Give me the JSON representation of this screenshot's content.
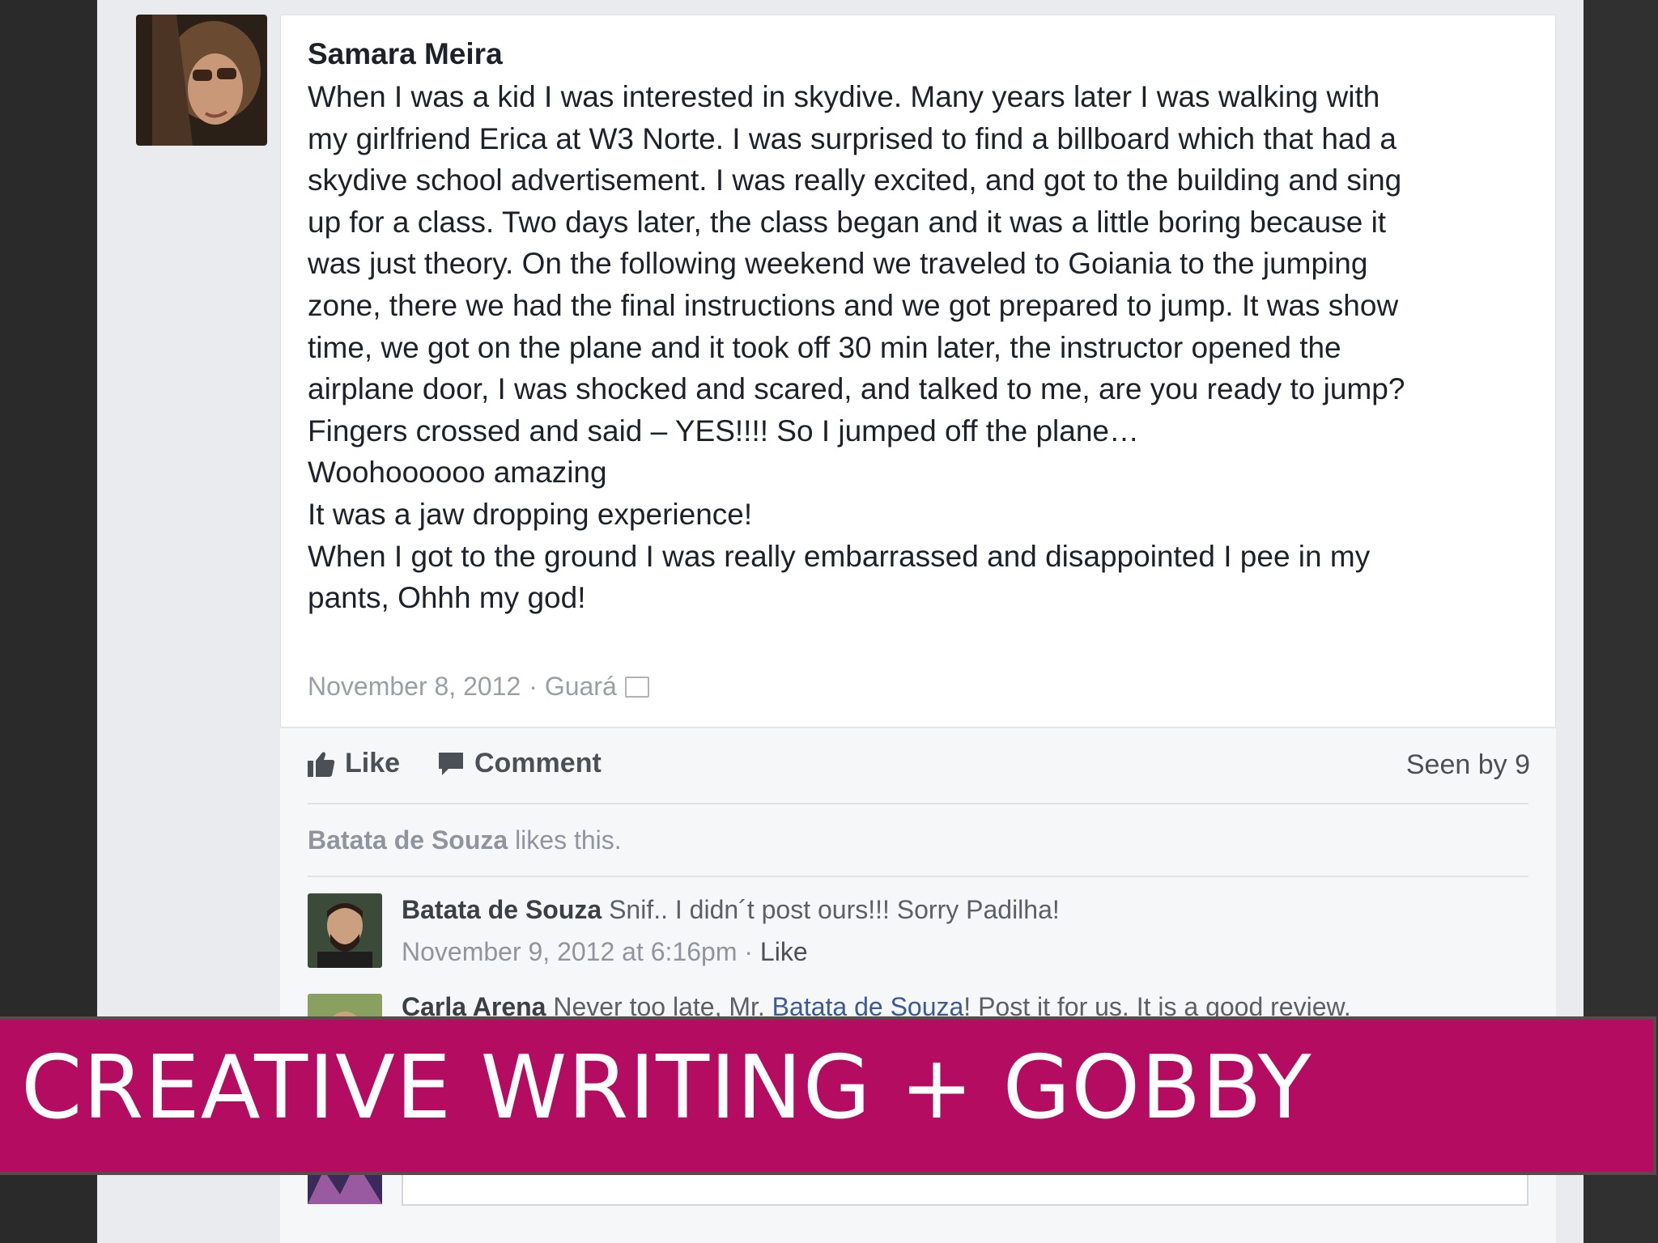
{
  "post": {
    "author": "Samara Meira",
    "lines": [
      "When I was a kid I was interested in skydive. Many years later I was walking with my girlfriend Erica at W3 Norte. I was surprised to find a billboard which that had a skydive school advertisement. I was really excited, and got to the building and sing up for a class. Two days later, the class began and it was a little boring because it was just theory. On the following weekend we traveled to Goiania to the jumping zone, there we had the final instructions and we got prepared to jump. It was show time, we got on the plane and it took off 30 min later, the instructor opened the airplane door, I was shocked and scared, and talked to me, are you ready to jump? Fingers crossed and said – YES!!!! So I jumped off the plane…",
      "Woohoooooo amazing",
      "It was a jaw dropping experience!",
      "When I got to the ground I was really embarrassed and disappointed I pee in my pants, Ohhh my god!"
    ],
    "date": "November 8, 2012",
    "location": "· Guará"
  },
  "actions": {
    "like": "Like",
    "comment": "Comment",
    "seen": "Seen by 9"
  },
  "likes": {
    "name": "Batata de Souza",
    "suffix": " likes this."
  },
  "comments": [
    {
      "author": "Batata de Souza",
      "text": " Snif.. I didn´t post ours!!! Sorry Padilha!",
      "time": "November 9, 2012 at 6:16pm · ",
      "like": "Like"
    },
    {
      "author": "Carla Arena",
      "text_before": " Never too late, Mr. ",
      "link": "Batata de Souza",
      "text_after": "! Post it for us. It is a good review."
    }
  ],
  "banner": {
    "title": "CREATIVE WRITING + GOBBY"
  },
  "colors": {
    "banner": "#b40c61",
    "link": "#3b5998"
  }
}
